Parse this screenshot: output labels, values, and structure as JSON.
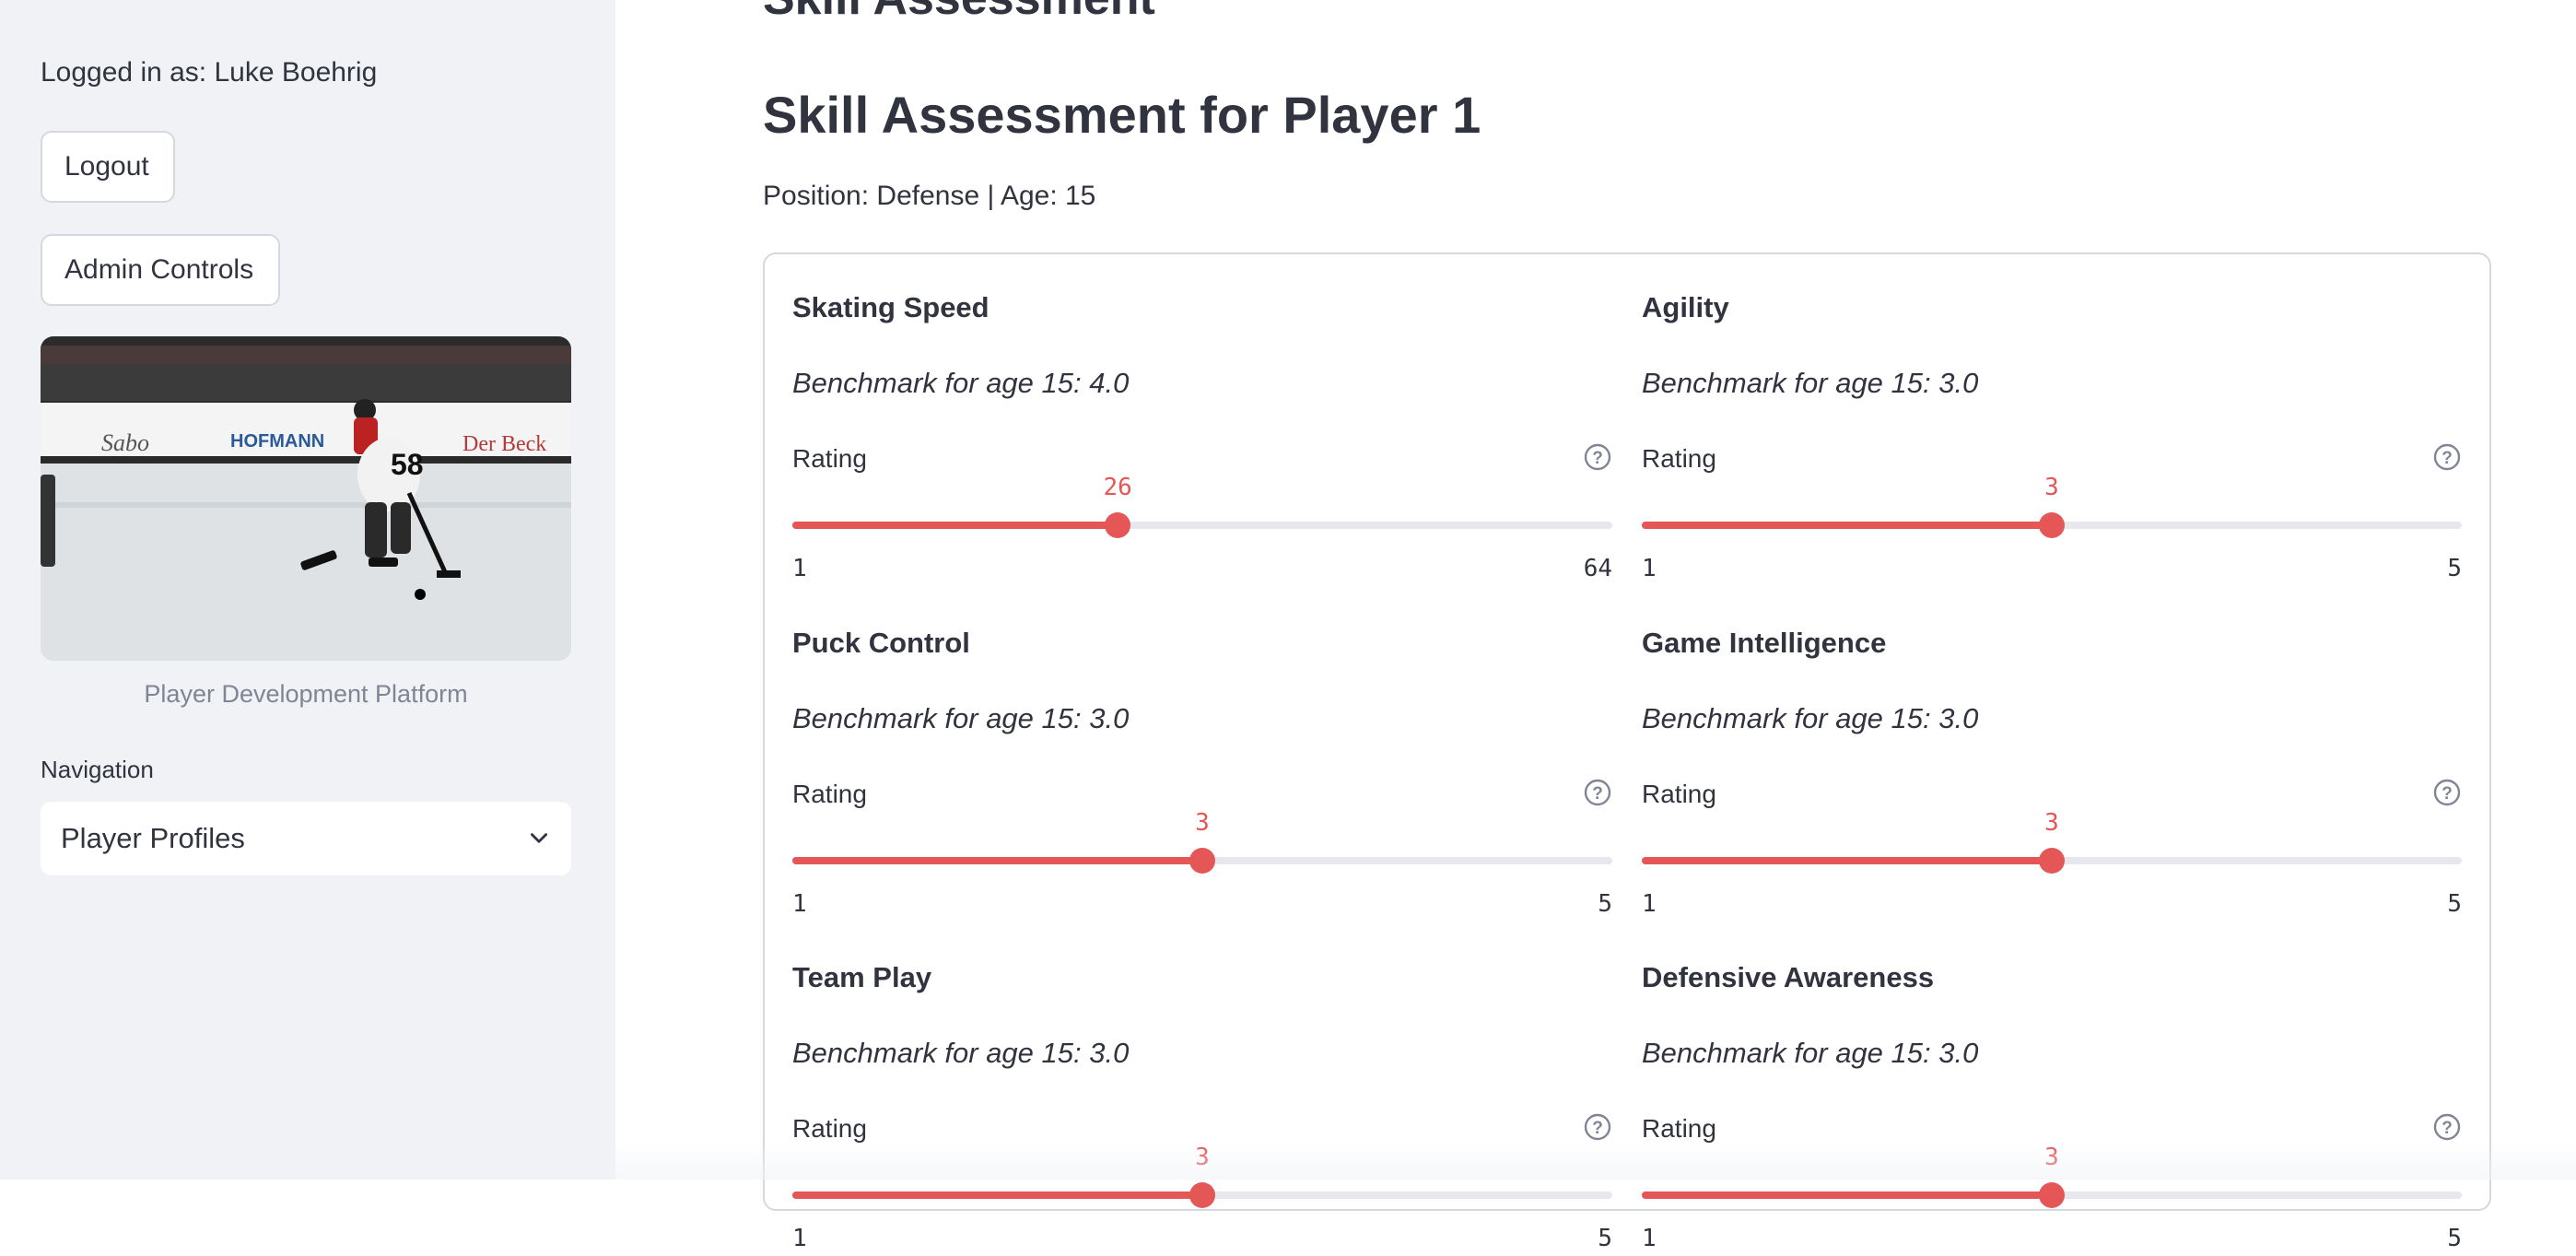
{
  "sidebar": {
    "logged_in": "Logged in as: Luke Boehrig",
    "logout_label": "Logout",
    "admin_label": "Admin Controls",
    "caption": "Player Development Platform",
    "nav_label": "Navigation",
    "nav_selected": "Player Profiles",
    "hero_image": {
      "board_text_1": "Sabo",
      "board_text_2": "HOFMANN",
      "board_text_3": "Der Beck",
      "jersey_number": "58"
    }
  },
  "main": {
    "prev_title": "Skill Assessment",
    "title": "Skill Assessment for Player 1",
    "subtitle": "Position: Defense | Age: 15",
    "skills": [
      {
        "name": "Skating Speed",
        "benchmark": "Benchmark for age 15: 4.0",
        "rating_label": "Rating",
        "value": 26,
        "min": 1,
        "max": 64
      },
      {
        "name": "Agility",
        "benchmark": "Benchmark for age 15: 3.0",
        "rating_label": "Rating",
        "value": 3,
        "min": 1,
        "max": 5
      },
      {
        "name": "Puck Control",
        "benchmark": "Benchmark for age 15: 3.0",
        "rating_label": "Rating",
        "value": 3,
        "min": 1,
        "max": 5
      },
      {
        "name": "Game Intelligence",
        "benchmark": "Benchmark for age 15: 3.0",
        "rating_label": "Rating",
        "value": 3,
        "min": 1,
        "max": 5
      },
      {
        "name": "Team Play",
        "benchmark": "Benchmark for age 15: 3.0",
        "rating_label": "Rating",
        "value": 3,
        "min": 1,
        "max": 5
      },
      {
        "name": "Defensive Awareness",
        "benchmark": "Benchmark for age 15: 3.0",
        "rating_label": "Rating",
        "value": 3,
        "min": 1,
        "max": 5
      }
    ]
  },
  "colors": {
    "accent": "#e45756",
    "sidebar_bg": "#f0f2f6",
    "text": "#31333f",
    "muted": "#808495",
    "track": "#e6e8ee"
  },
  "icons": {
    "help": "help-circle-icon",
    "dropdown": "chevron-down-icon"
  }
}
